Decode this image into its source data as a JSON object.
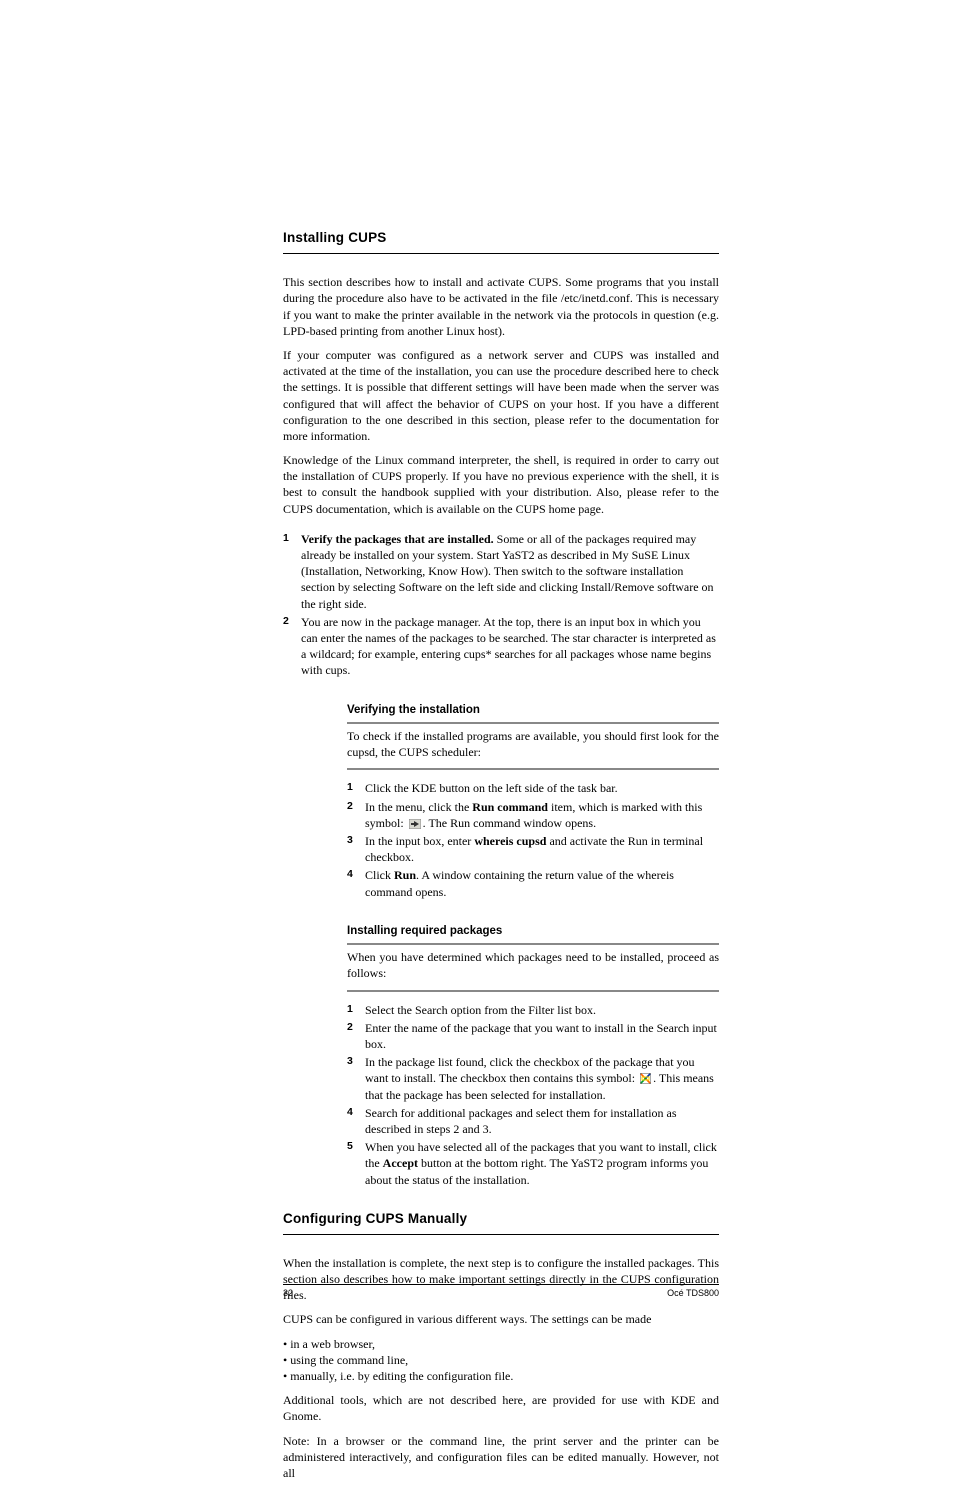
{
  "section_heading": "Installing CUPS",
  "intro_p1": "This section describes how to install and activate CUPS. Some programs that you install during the procedure also have to be activated in the file /etc/inetd.conf. This is necessary if you want to make the printer available in the network via the protocols in question (e.g. LPD-based printing from another Linux host).",
  "intro_p2": "If your computer was configured as a network server and CUPS was installed and activated at the time of the installation, you can use the procedure described here to check the settings. It is possible that different settings will have been made when the server was configured that will affect the behavior of CUPS on your host. If you have a different configuration to the one described in this section, please refer to the documentation for more information.",
  "intro_p3": "Knowledge of the Linux command interpreter, the shell, is required in order to carry out the installation of CUPS properly. If you have no previous experience with the shell, it is best to consult the handbook supplied with your distribution. Also, please refer to the CUPS documentation, which is available on the CUPS home page.",
  "step1": {
    "num": "1",
    "text_before_bold": "Verify the packages that are installed.",
    "text_after": " Some or all of the packages required may already be installed on your system. Start YaST2 as described in My SuSE Linux (Installation, Networking, Know How). Then switch to the software installation section by selecting Software on the left side and clicking Install/Remove software on the right side."
  },
  "step2": {
    "num": "2",
    "text": "You are now in the package manager. At the top, there is an input box in which you can enter the names of the packages to be searched. The star character is interpreted as a wildcard; for example, entering cups* searches for all packages whose name begins with cups."
  },
  "block1": {
    "heading": "Verifying the installation",
    "p1": "To check if the installed programs are available, you should first look for the cupsd, the CUPS scheduler:",
    "s1": {
      "num": "1",
      "text": "Click the KDE button on the left side of the task bar."
    },
    "s2": {
      "num": "2",
      "before": "In the menu, click the ",
      "bold": "Run command",
      "after1": " item, which is marked with this symbol: ",
      "after2": ". The Run command window opens."
    },
    "s3": {
      "num": "3",
      "before": "In the input box, enter ",
      "bold": "whereis cupsd",
      "after": " and activate the Run in terminal checkbox."
    },
    "s4": {
      "num": "4",
      "before": "Click ",
      "bold": "Run",
      "after": ". A window containing the return value of the whereis command opens."
    }
  },
  "block2": {
    "heading": "Installing required packages",
    "p1": "When you have determined which packages need to be installed, proceed as follows:",
    "s1": {
      "num": "1",
      "text": "Select the Search option from the Filter list box."
    },
    "s2": {
      "num": "2",
      "text": "Enter the name of the package that you want to install in the Search input box."
    },
    "s3": {
      "num": "3",
      "before": "In the package list found, click the checkbox of the package that you want to install. The checkbox then contains this symbol: ",
      "after": ". This means that the package has been selected for installation."
    },
    "s4": {
      "num": "4",
      "text": "Search for additional packages and select them for installation as described in steps 2 and 3."
    },
    "s5": {
      "num": "5",
      "before": "When you have selected all of the packages that you want to install, click the ",
      "bold": "Accept",
      "after": " button at the bottom right. The YaST2 program informs you about the status of the installation."
    }
  },
  "section2_heading": "Configuring CUPS Manually",
  "sec2_p1": "When the installation is complete, the next step is to configure the installed packages. This section also describes how to make important settings directly in the CUPS configuration files.",
  "sec2_p2": "CUPS can be configured in various different ways. The settings can be made",
  "sec2_b1": "• in a web browser,",
  "sec2_b2": "• using the command line,",
  "sec2_b3": "• manually, i.e. by editing the configuration file.",
  "sec2_p3": "Additional tools, which are not described here, are provided for use with KDE and Gnome.",
  "sec2_p4": "Note: In a browser or the command line, the print server and the printer can be administered interactively, and configuration files can be edited manually. However, not all",
  "footer": {
    "left": "32",
    "right": "Océ TDS800"
  }
}
